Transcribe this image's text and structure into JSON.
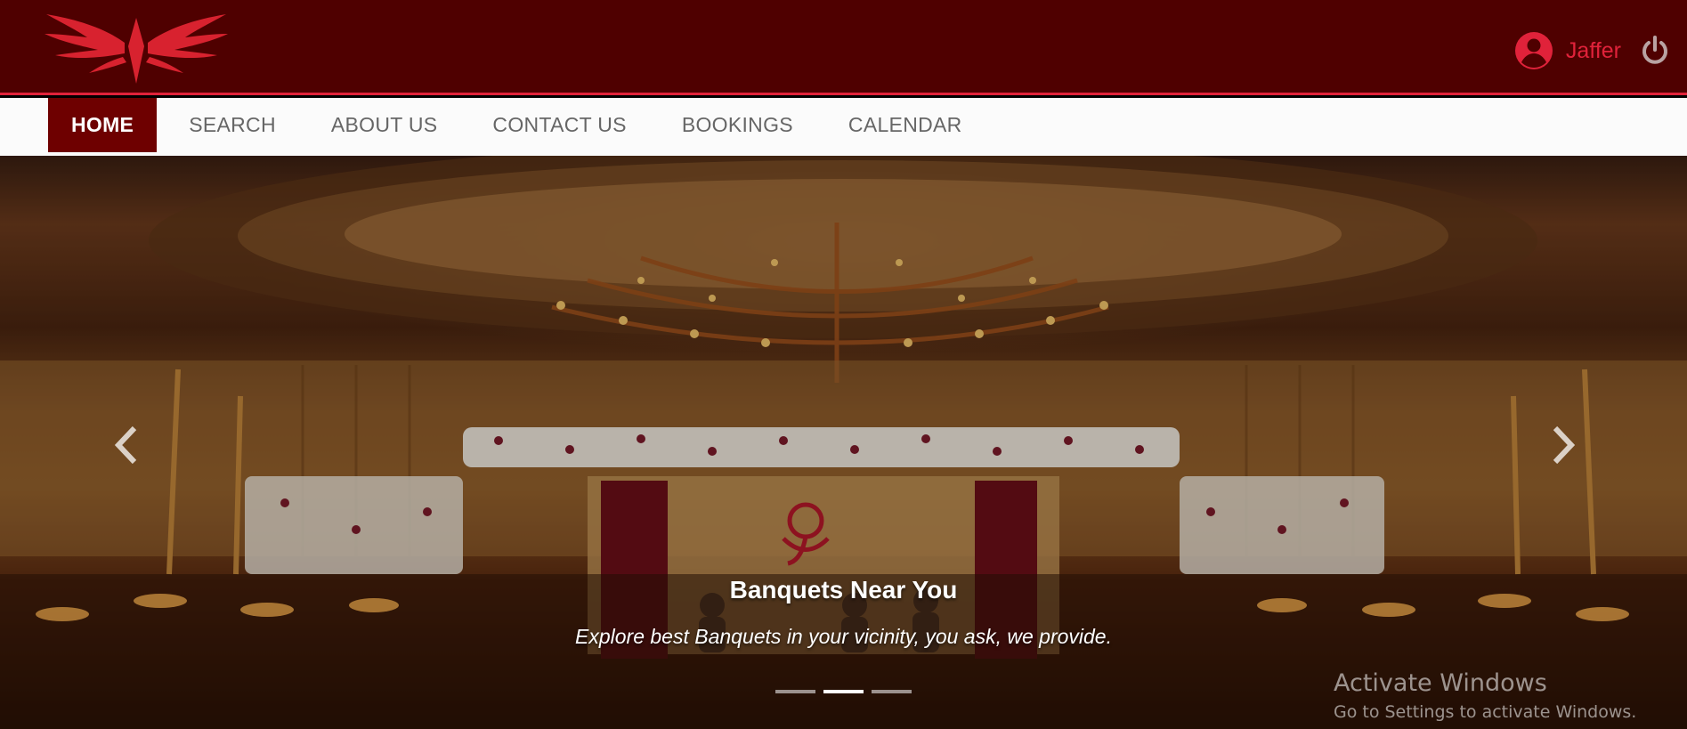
{
  "header": {
    "logo_icon": "winged-logo-icon",
    "user_icon": "user-circle-icon",
    "user_name": "Jaffer",
    "power_icon": "power-icon",
    "accent_color": "#e0223a",
    "background_color": "#4f0000"
  },
  "nav": {
    "items": [
      {
        "label": "HOME",
        "active": true
      },
      {
        "label": "SEARCH",
        "active": false
      },
      {
        "label": "ABOUT US",
        "active": false
      },
      {
        "label": "CONTACT US",
        "active": false
      },
      {
        "label": "BOOKINGS",
        "active": false
      },
      {
        "label": "CALENDAR",
        "active": false
      }
    ],
    "active_color": "#6e0000"
  },
  "carousel": {
    "slide_title": "Banquets Near You",
    "slide_subtitle": "Explore best Banquets in your vicinity, you ask, we provide.",
    "prev_icon": "chevron-left-icon",
    "next_icon": "chevron-right-icon",
    "indicators": 3,
    "active_indicator": 2
  },
  "watermark": {
    "title": "Activate Windows",
    "subtitle": "Go to Settings to activate Windows."
  }
}
